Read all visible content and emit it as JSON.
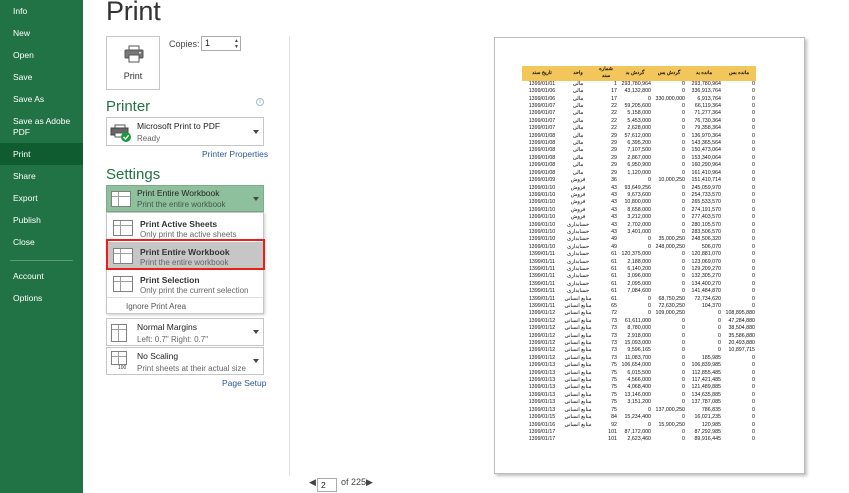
{
  "nav": {
    "items": [
      "Info",
      "New",
      "Open",
      "Save",
      "Save As",
      "Save as Adobe PDF",
      "Print",
      "Share",
      "Export",
      "Publish",
      "Close",
      "Account",
      "Options"
    ],
    "active": "Print"
  },
  "title": "Print",
  "print_button": {
    "label": "Print"
  },
  "copies": {
    "label": "Copies:",
    "value": "1"
  },
  "printer": {
    "heading": "Printer",
    "name": "Microsoft Print to PDF",
    "status": "Ready",
    "properties_link": "Printer Properties",
    "info_icon": "i"
  },
  "settings": {
    "heading": "Settings",
    "selected": {
      "title": "Print Entire Workbook",
      "subtitle": "Print the entire workbook"
    },
    "menu": [
      {
        "title": "Print Active Sheets",
        "subtitle": "Only print the active sheets"
      },
      {
        "title": "Print Entire Workbook",
        "subtitle": "Print the entire workbook"
      },
      {
        "title": "Print Selection",
        "subtitle": "Only print the current selection"
      }
    ],
    "ignore_print_area": "Ignore Print Area",
    "margins": {
      "title": "Normal Margins",
      "subtitle": "Left:  0.7\"    Right:  0.7\""
    },
    "scaling": {
      "title": "No Scaling",
      "subtitle": "Print sheets at their actual size",
      "badge": "100"
    },
    "page_setup_link": "Page Setup"
  },
  "pager": {
    "current": "2",
    "of_text": "of 225"
  },
  "preview": {
    "headers": [
      "تاریخ سند",
      "واحد",
      "شماره سند",
      "گردش بد",
      "گردش بس",
      "مانده بد",
      "مانده بس"
    ],
    "rows": [
      [
        "1399/01/01",
        "مالی",
        "1",
        "293,780,964",
        "0",
        "293,780,964",
        "0"
      ],
      [
        "1399/01/06",
        "مالی",
        "17",
        "43,132,800",
        "0",
        "336,913,764",
        "0"
      ],
      [
        "1399/01/06",
        "مالی",
        "17",
        "0",
        "330,000,000",
        "6,913,764",
        "0"
      ],
      [
        "1399/01/07",
        "مالی",
        "22",
        "59,205,600",
        "0",
        "66,119,364",
        "0"
      ],
      [
        "1399/01/07",
        "مالی",
        "22",
        "5,158,000",
        "0",
        "71,277,364",
        "0"
      ],
      [
        "1399/01/07",
        "مالی",
        "22",
        "5,453,000",
        "0",
        "76,730,364",
        "0"
      ],
      [
        "1399/01/07",
        "مالی",
        "22",
        "2,628,000",
        "0",
        "79,358,364",
        "0"
      ],
      [
        "1399/01/08",
        "مالی",
        "29",
        "57,612,000",
        "0",
        "136,970,364",
        "0"
      ],
      [
        "1399/01/08",
        "مالی",
        "29",
        "6,395,200",
        "0",
        "143,365,564",
        "0"
      ],
      [
        "1399/01/08",
        "مالی",
        "29",
        "7,107,500",
        "0",
        "150,473,064",
        "0"
      ],
      [
        "1399/01/08",
        "مالی",
        "29",
        "2,867,000",
        "0",
        "153,340,064",
        "0"
      ],
      [
        "1399/01/08",
        "مالی",
        "29",
        "6,950,900",
        "0",
        "160,290,964",
        "0"
      ],
      [
        "1399/01/08",
        "مالی",
        "29",
        "1,120,000",
        "0",
        "161,410,964",
        "0"
      ],
      [
        "1399/01/09",
        "فروش",
        "36",
        "0",
        "10,000,250",
        "151,410,714",
        "0"
      ],
      [
        "1399/01/10",
        "فروش",
        "43",
        "93,649,256",
        "0",
        "245,059,970",
        "0"
      ],
      [
        "1399/01/10",
        "فروش",
        "43",
        "9,673,600",
        "0",
        "254,733,570",
        "0"
      ],
      [
        "1399/01/10",
        "فروش",
        "43",
        "10,800,000",
        "0",
        "265,533,570",
        "0"
      ],
      [
        "1399/01/10",
        "فروش",
        "43",
        "8,658,000",
        "0",
        "274,191,570",
        "0"
      ],
      [
        "1399/01/10",
        "فروش",
        "43",
        "3,212,000",
        "0",
        "277,403,570",
        "0"
      ],
      [
        "1399/01/10",
        "حسابداری",
        "43",
        "2,702,000",
        "0",
        "280,105,570",
        "0"
      ],
      [
        "1399/01/10",
        "حسابداری",
        "43",
        "3,401,000",
        "0",
        "283,506,570",
        "0"
      ],
      [
        "1399/01/10",
        "حسابداری",
        "49",
        "0",
        "35,000,250",
        "248,506,320",
        "0"
      ],
      [
        "1399/01/10",
        "حسابداری",
        "49",
        "0",
        "248,000,250",
        "506,070",
        "0"
      ],
      [
        "1399/01/11",
        "حسابداری",
        "61",
        "120,375,000",
        "0",
        "120,881,070",
        "0"
      ],
      [
        "1399/01/11",
        "حسابداری",
        "61",
        "2,188,000",
        "0",
        "123,069,070",
        "0"
      ],
      [
        "1399/01/11",
        "حسابداری",
        "61",
        "6,140,200",
        "0",
        "129,209,270",
        "0"
      ],
      [
        "1399/01/11",
        "حسابداری",
        "61",
        "3,096,000",
        "0",
        "132,305,270",
        "0"
      ],
      [
        "1399/01/11",
        "حسابداری",
        "61",
        "2,095,000",
        "0",
        "134,400,270",
        "0"
      ],
      [
        "1399/01/11",
        "حسابداری",
        "61",
        "7,084,600",
        "0",
        "141,484,870",
        "0"
      ],
      [
        "1399/01/11",
        "منابع انسانی",
        "61",
        "0",
        "68,750,250",
        "72,734,620",
        "0"
      ],
      [
        "1399/01/11",
        "منابع انسانی",
        "65",
        "0",
        "72,630,250",
        "104,370",
        "0"
      ],
      [
        "1399/01/12",
        "منابع انسانی",
        "72",
        "0",
        "109,000,250",
        "0",
        "108,895,880"
      ],
      [
        "1399/01/12",
        "منابع انسانی",
        "73",
        "61,611,000",
        "0",
        "0",
        "47,284,880"
      ],
      [
        "1399/01/12",
        "منابع انسانی",
        "73",
        "8,780,000",
        "0",
        "0",
        "38,504,880"
      ],
      [
        "1399/01/12",
        "منابع انسانی",
        "73",
        "2,918,000",
        "0",
        "0",
        "35,586,880"
      ],
      [
        "1399/01/12",
        "منابع انسانی",
        "73",
        "15,093,000",
        "0",
        "0",
        "20,493,880"
      ],
      [
        "1399/01/12",
        "منابع انسانی",
        "73",
        "9,596,165",
        "0",
        "0",
        "10,897,715"
      ],
      [
        "1399/01/12",
        "منابع انسانی",
        "73",
        "11,083,700",
        "0",
        "185,985",
        "0"
      ],
      [
        "1399/01/13",
        "منابع انسانی",
        "75",
        "106,654,000",
        "0",
        "106,839,985",
        "0"
      ],
      [
        "1399/01/13",
        "منابع انسانی",
        "75",
        "6,015,500",
        "0",
        "112,855,485",
        "0"
      ],
      [
        "1399/01/13",
        "منابع انسانی",
        "75",
        "4,566,000",
        "0",
        "117,421,485",
        "0"
      ],
      [
        "1399/01/13",
        "منابع انسانی",
        "75",
        "4,068,400",
        "0",
        "121,489,885",
        "0"
      ],
      [
        "1399/01/13",
        "منابع انسانی",
        "75",
        "13,146,000",
        "0",
        "134,635,885",
        "0"
      ],
      [
        "1399/01/13",
        "منابع انسانی",
        "75",
        "3,151,200",
        "0",
        "137,787,085",
        "0"
      ],
      [
        "1399/01/13",
        "منابع انسانی",
        "75",
        "0",
        "137,000,250",
        "786,835",
        "0"
      ],
      [
        "1399/01/15",
        "منابع انسانی",
        "84",
        "15,234,400",
        "0",
        "16,021,235",
        "0"
      ],
      [
        "1399/01/16",
        "منابع انسانی",
        "92",
        "0",
        "15,900,250",
        "120,985",
        "0"
      ],
      [
        "1399/01/17",
        "",
        "101",
        "87,172,000",
        "0",
        "87,292,985",
        "0"
      ],
      [
        "1399/01/17",
        "",
        "101",
        "2,623,460",
        "0",
        "89,916,445",
        "0"
      ]
    ]
  }
}
